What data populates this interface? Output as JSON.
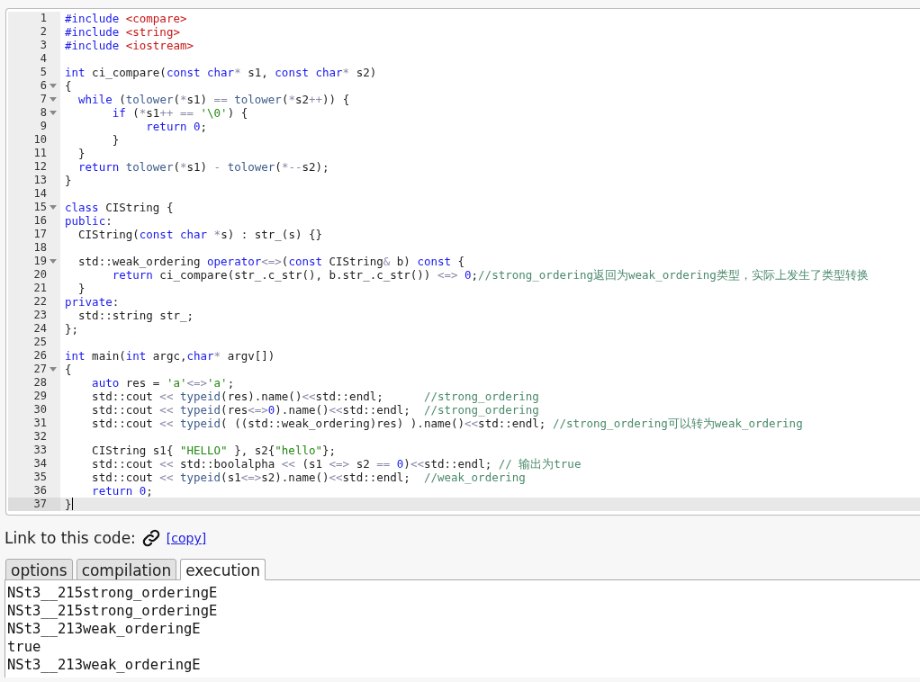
{
  "editor": {
    "lines": [
      {
        "number": "1",
        "fold": false,
        "active": false,
        "tokens": [
          {
            "kind": "keyword",
            "text": "#include "
          },
          {
            "kind": "header",
            "text": "<compare>"
          }
        ]
      },
      {
        "number": "2",
        "fold": false,
        "active": false,
        "tokens": [
          {
            "kind": "keyword",
            "text": "#include "
          },
          {
            "kind": "header",
            "text": "<string>"
          }
        ]
      },
      {
        "number": "3",
        "fold": false,
        "active": false,
        "tokens": [
          {
            "kind": "keyword",
            "text": "#include "
          },
          {
            "kind": "header",
            "text": "<iostream>"
          }
        ]
      },
      {
        "number": "4",
        "fold": false,
        "active": false
      },
      {
        "number": "5",
        "fold": false,
        "active": false,
        "tokens": [
          {
            "kind": "keyword",
            "text": "int"
          },
          {
            "kind": "plain",
            "text": " ci_compare("
          },
          {
            "kind": "keyword",
            "text": "const char"
          },
          {
            "kind": "operator",
            "text": "*"
          },
          {
            "kind": "plain",
            "text": " s1, "
          },
          {
            "kind": "keyword",
            "text": "const char"
          },
          {
            "kind": "operator",
            "text": "*"
          },
          {
            "kind": "plain",
            "text": " s2)"
          }
        ]
      },
      {
        "number": "6",
        "fold": true,
        "active": false,
        "tokens": [
          {
            "kind": "plain",
            "text": "{"
          }
        ]
      },
      {
        "number": "7",
        "fold": true,
        "active": false,
        "tokens": [
          {
            "kind": "keyword",
            "text": "  while"
          },
          {
            "kind": "plain",
            "text": " ("
          },
          {
            "kind": "builtin",
            "text": "tolower"
          },
          {
            "kind": "plain",
            "text": "("
          },
          {
            "kind": "operator",
            "text": "*"
          },
          {
            "kind": "plain",
            "text": "s1) "
          },
          {
            "kind": "operator",
            "text": "=="
          },
          {
            "kind": "builtin",
            "text": " tolower"
          },
          {
            "kind": "plain",
            "text": "("
          },
          {
            "kind": "operator",
            "text": "*"
          },
          {
            "kind": "plain",
            "text": "s2"
          },
          {
            "kind": "operator",
            "text": "++"
          },
          {
            "kind": "plain",
            "text": ")) {"
          }
        ]
      },
      {
        "number": "8",
        "fold": true,
        "active": false,
        "tokens": [
          {
            "kind": "keyword",
            "text": "       if"
          },
          {
            "kind": "plain",
            "text": " ("
          },
          {
            "kind": "operator",
            "text": "*"
          },
          {
            "kind": "plain",
            "text": "s1"
          },
          {
            "kind": "operator",
            "text": "++ == "
          },
          {
            "kind": "string",
            "text": "'\\0'"
          },
          {
            "kind": "plain",
            "text": ") {"
          }
        ]
      },
      {
        "number": "9",
        "fold": false,
        "active": false,
        "tokens": [
          {
            "kind": "keyword",
            "text": "            return "
          },
          {
            "kind": "number",
            "text": "0"
          },
          {
            "kind": "plain",
            "text": ";"
          }
        ]
      },
      {
        "number": "10",
        "fold": false,
        "active": false,
        "tokens": [
          {
            "kind": "plain",
            "text": "       }"
          }
        ]
      },
      {
        "number": "11",
        "fold": false,
        "active": false,
        "tokens": [
          {
            "kind": "plain",
            "text": "  }"
          }
        ]
      },
      {
        "number": "12",
        "fold": false,
        "active": false,
        "tokens": [
          {
            "kind": "keyword",
            "text": "  return "
          },
          {
            "kind": "builtin",
            "text": "tolower"
          },
          {
            "kind": "plain",
            "text": "("
          },
          {
            "kind": "operator",
            "text": "*"
          },
          {
            "kind": "plain",
            "text": "s1) "
          },
          {
            "kind": "operator",
            "text": "- "
          },
          {
            "kind": "builtin",
            "text": "tolower"
          },
          {
            "kind": "plain",
            "text": "("
          },
          {
            "kind": "operator",
            "text": "*--"
          },
          {
            "kind": "plain",
            "text": "s2);"
          }
        ]
      },
      {
        "number": "13",
        "fold": false,
        "active": false,
        "tokens": [
          {
            "kind": "plain",
            "text": "}"
          }
        ]
      },
      {
        "number": "14",
        "fold": false,
        "active": false
      },
      {
        "number": "15",
        "fold": true,
        "active": false,
        "tokens": [
          {
            "kind": "keyword",
            "text": "class"
          },
          {
            "kind": "plain",
            "text": " CIString {"
          }
        ]
      },
      {
        "number": "16",
        "fold": false,
        "active": false,
        "tokens": [
          {
            "kind": "keyword",
            "text": "public"
          },
          {
            "kind": "plain",
            "text": ":"
          }
        ]
      },
      {
        "number": "17",
        "fold": false,
        "active": false,
        "tokens": [
          {
            "kind": "plain",
            "text": "  CIString("
          },
          {
            "kind": "keyword",
            "text": "const char "
          },
          {
            "kind": "operator",
            "text": "*"
          },
          {
            "kind": "plain",
            "text": "s) : str_(s) {}"
          }
        ]
      },
      {
        "number": "18",
        "fold": false,
        "active": false
      },
      {
        "number": "19",
        "fold": true,
        "active": false,
        "tokens": [
          {
            "kind": "plain",
            "text": "  std::weak_ordering "
          },
          {
            "kind": "keyword",
            "text": "operator"
          },
          {
            "kind": "operator",
            "text": "<=>"
          },
          {
            "kind": "plain",
            "text": "("
          },
          {
            "kind": "keyword",
            "text": "const"
          },
          {
            "kind": "plain",
            "text": " CIString"
          },
          {
            "kind": "operator",
            "text": "&"
          },
          {
            "kind": "plain",
            "text": " b) "
          },
          {
            "kind": "keyword",
            "text": "const"
          },
          {
            "kind": "plain",
            "text": " {"
          }
        ]
      },
      {
        "number": "20",
        "fold": false,
        "active": false,
        "tokens": [
          {
            "kind": "keyword",
            "text": "       return"
          },
          {
            "kind": "plain",
            "text": " ci_compare(str_.c_str(), b.str_.c_str()) "
          },
          {
            "kind": "operator",
            "text": "<=> "
          },
          {
            "kind": "number",
            "text": "0"
          },
          {
            "kind": "plain",
            "text": ";"
          },
          {
            "kind": "comment",
            "text": "//strong_ordering返回为weak_ordering类型，实际上发生了类型转换"
          }
        ]
      },
      {
        "number": "21",
        "fold": false,
        "active": false,
        "tokens": [
          {
            "kind": "plain",
            "text": "  }"
          }
        ]
      },
      {
        "number": "22",
        "fold": false,
        "active": false,
        "tokens": [
          {
            "kind": "keyword",
            "text": "private"
          },
          {
            "kind": "plain",
            "text": ":"
          }
        ]
      },
      {
        "number": "23",
        "fold": false,
        "active": false,
        "tokens": [
          {
            "kind": "plain",
            "text": "  std::string str_;"
          }
        ]
      },
      {
        "number": "24",
        "fold": false,
        "active": false,
        "tokens": [
          {
            "kind": "plain",
            "text": "};"
          }
        ]
      },
      {
        "number": "25",
        "fold": false,
        "active": false
      },
      {
        "number": "26",
        "fold": false,
        "active": false,
        "tokens": [
          {
            "kind": "keyword",
            "text": "int"
          },
          {
            "kind": "plain",
            "text": " main("
          },
          {
            "kind": "keyword",
            "text": "int"
          },
          {
            "kind": "plain",
            "text": " argc,"
          },
          {
            "kind": "keyword",
            "text": "char"
          },
          {
            "kind": "operator",
            "text": "*"
          },
          {
            "kind": "plain",
            "text": " argv[])"
          }
        ]
      },
      {
        "number": "27",
        "fold": true,
        "active": false,
        "tokens": [
          {
            "kind": "plain",
            "text": "{"
          }
        ]
      },
      {
        "number": "28",
        "fold": false,
        "active": false,
        "tokens": [
          {
            "kind": "keyword",
            "text": "    auto"
          },
          {
            "kind": "plain",
            "text": " res = "
          },
          {
            "kind": "string",
            "text": "'a'"
          },
          {
            "kind": "operator",
            "text": "<=>"
          },
          {
            "kind": "string",
            "text": "'a'"
          },
          {
            "kind": "plain",
            "text": ";"
          }
        ]
      },
      {
        "number": "29",
        "fold": false,
        "active": false,
        "tokens": [
          {
            "kind": "plain",
            "text": "    std::cout "
          },
          {
            "kind": "operator",
            "text": "<<"
          },
          {
            "kind": "builtin",
            "text": " typeid"
          },
          {
            "kind": "plain",
            "text": "(res).name()"
          },
          {
            "kind": "operator",
            "text": "<<"
          },
          {
            "kind": "plain",
            "text": "std::endl;      "
          },
          {
            "kind": "comment",
            "text": "//strong_ordering"
          }
        ]
      },
      {
        "number": "30",
        "fold": false,
        "active": false,
        "tokens": [
          {
            "kind": "plain",
            "text": "    std::cout "
          },
          {
            "kind": "operator",
            "text": "<<"
          },
          {
            "kind": "builtin",
            "text": " typeid"
          },
          {
            "kind": "plain",
            "text": "(res"
          },
          {
            "kind": "operator",
            "text": "<=>"
          },
          {
            "kind": "number",
            "text": "0"
          },
          {
            "kind": "plain",
            "text": ").name()"
          },
          {
            "kind": "operator",
            "text": "<<"
          },
          {
            "kind": "plain",
            "text": "std::endl;  "
          },
          {
            "kind": "comment",
            "text": "//strong_ordering"
          }
        ]
      },
      {
        "number": "31",
        "fold": false,
        "active": false,
        "tokens": [
          {
            "kind": "plain",
            "text": "    std::cout "
          },
          {
            "kind": "operator",
            "text": "<<"
          },
          {
            "kind": "builtin",
            "text": " typeid"
          },
          {
            "kind": "plain",
            "text": "( ((std::weak_ordering)res) ).name()"
          },
          {
            "kind": "operator",
            "text": "<<"
          },
          {
            "kind": "plain",
            "text": "std::endl; "
          },
          {
            "kind": "comment",
            "text": "//strong_ordering可以转为weak_ordering"
          }
        ]
      },
      {
        "number": "32",
        "fold": false,
        "active": false
      },
      {
        "number": "33",
        "fold": false,
        "active": false,
        "tokens": [
          {
            "kind": "plain",
            "text": "    CIString s1{ "
          },
          {
            "kind": "string",
            "text": "\"HELLO\""
          },
          {
            "kind": "plain",
            "text": " }, s2{"
          },
          {
            "kind": "string",
            "text": "\"hello\""
          },
          {
            "kind": "plain",
            "text": "};"
          }
        ]
      },
      {
        "number": "34",
        "fold": false,
        "active": false,
        "tokens": [
          {
            "kind": "plain",
            "text": "    std::cout "
          },
          {
            "kind": "operator",
            "text": "<<"
          },
          {
            "kind": "plain",
            "text": " std::boolalpha "
          },
          {
            "kind": "operator",
            "text": "<<"
          },
          {
            "kind": "plain",
            "text": " (s1 "
          },
          {
            "kind": "operator",
            "text": "<=>"
          },
          {
            "kind": "plain",
            "text": " s2 "
          },
          {
            "kind": "operator",
            "text": "== "
          },
          {
            "kind": "number",
            "text": "0"
          },
          {
            "kind": "plain",
            "text": ")"
          },
          {
            "kind": "operator",
            "text": "<<"
          },
          {
            "kind": "plain",
            "text": "std::endl; "
          },
          {
            "kind": "comment",
            "text": "// 输出为true"
          }
        ]
      },
      {
        "number": "35",
        "fold": false,
        "active": false,
        "tokens": [
          {
            "kind": "plain",
            "text": "    std::cout "
          },
          {
            "kind": "operator",
            "text": "<<"
          },
          {
            "kind": "builtin",
            "text": " typeid"
          },
          {
            "kind": "plain",
            "text": "(s1"
          },
          {
            "kind": "operator",
            "text": "<=>"
          },
          {
            "kind": "plain",
            "text": "s2).name()"
          },
          {
            "kind": "operator",
            "text": "<<"
          },
          {
            "kind": "plain",
            "text": "std::endl;  "
          },
          {
            "kind": "comment",
            "text": "//weak_ordering"
          }
        ]
      },
      {
        "number": "36",
        "fold": false,
        "active": false,
        "tokens": [
          {
            "kind": "keyword",
            "text": "    return "
          },
          {
            "kind": "number",
            "text": "0"
          },
          {
            "kind": "plain",
            "text": ";"
          }
        ]
      },
      {
        "number": "37",
        "fold": false,
        "active": true,
        "tokens": [
          {
            "kind": "plain",
            "text": "}"
          }
        ]
      }
    ]
  },
  "link": {
    "label": "Link to this code:",
    "copy": "[copy]"
  },
  "tabs": [
    {
      "label": "options",
      "selected": false
    },
    {
      "label": "compilation",
      "selected": false
    },
    {
      "label": "execution",
      "selected": true
    }
  ],
  "output": [
    "NSt3__215strong_orderingE",
    "NSt3__215strong_orderingE",
    "NSt3__213weak_orderingE",
    "true",
    "NSt3__213weak_orderingE"
  ]
}
